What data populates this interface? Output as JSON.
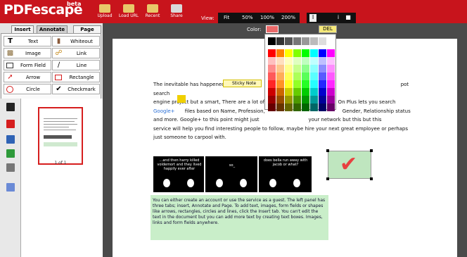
{
  "app": {
    "logo": "PDFescape",
    "beta": "beta"
  },
  "toolbar": {
    "buttons": [
      "Upload",
      "Load URL",
      "Recent",
      "Share"
    ],
    "view_label": "View:",
    "zoom": [
      "Fit",
      "50%",
      "100%",
      "200%"
    ],
    "tools": [
      "I",
      "i"
    ]
  },
  "tabs": {
    "insert": "Insert",
    "annotate": "Annotate",
    "page": "Page"
  },
  "insert_buttons": [
    "Text",
    "Whiteout",
    "Image",
    "Link",
    "Form Field",
    "Line",
    "Arrow",
    "Rectangle",
    "Circle",
    "Checkmark"
  ],
  "color": {
    "label": "Color:",
    "current": "#ea6a6a",
    "delete_label": "DEL"
  },
  "thumbnail": {
    "label": "1 of 1"
  },
  "document": {
    "para_start": "The inevitable has happened",
    "sticky_note": "Sticky Note",
    "line1_tail": "pot search",
    "line2": "engine project but a smart, There are a lot of fa",
    "line2_tail": "People On Plus lets you search",
    "link": "Google+",
    "line3": "files based on Name, Profession,",
    "line3_tail": "Gender, Relationship status",
    "line4": "and more. Google+ to this point might just",
    "line4_tail": "your network but this but this",
    "line5": "service will help you find interesting people to follow, maybe hire your next great employee or perhaps",
    "line6": "just someone to carpool with."
  },
  "comic": {
    "panel1": "...and then harry killed voldemort and they lived happily ever after",
    "panel2": "so_",
    "panel3": "does bella run away with jacob or what?"
  },
  "note_box": "You can either create an account or use the service as a guest. The left panel has three tabs; insert, Annotate and Page. To add text, images, form fields or shapes like arrows, rectangles, circles and lines, click the Insert tab. You can't edit the text in the document but you can add more text by creating text boxes. Images, links and form fields anywhere."
}
